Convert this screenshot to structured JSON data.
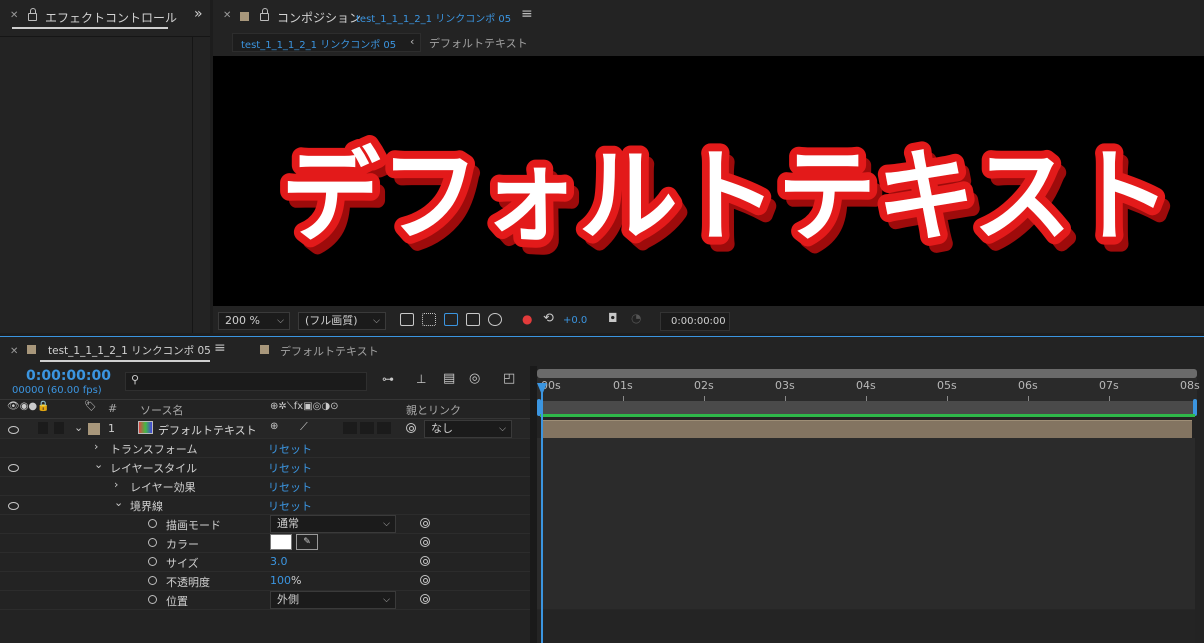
{
  "effects_panel": {
    "title": "エフェクトコントロール"
  },
  "comp_panel": {
    "title": "コンポジション",
    "comp_name": "test_1_1_1_2_1 リンクコンポ 05",
    "breadcrumb": [
      "test_1_1_1_2_1 リンクコンポ 05",
      "デフォルトテキスト"
    ],
    "preview_text": "デフォルトテキスト",
    "zoom": "200 %",
    "resolution": "(フル画質)",
    "exposure": "+0.0",
    "timecode": "0:00:00:00"
  },
  "timeline": {
    "tabs": [
      "test_1_1_1_2_1 リンクコンポ 05",
      "デフォルトテキスト"
    ],
    "current_time": "0:00:00:00",
    "frame_info": "00000 (60.00 fps)",
    "search_placeholder": "",
    "columns": {
      "num": "#",
      "source": "ソース名",
      "parent": "親とリンク"
    },
    "ruler": [
      "00s",
      "01s",
      "02s",
      "03s",
      "04s",
      "05s",
      "06s",
      "07s",
      "08s"
    ],
    "layer": {
      "num": "1",
      "name": "デフォルトテキスト",
      "parent": "なし"
    },
    "reset_label": "リセット",
    "props": {
      "transform": "トランスフォーム",
      "layer_style": "レイヤースタイル",
      "layer_effect": "レイヤー効果",
      "stroke": "境界線",
      "blend_mode": {
        "label": "描画モード",
        "value": "通常"
      },
      "color": {
        "label": "カラー",
        "value": "#ffffff"
      },
      "size": {
        "label": "サイズ",
        "value": "3.0"
      },
      "opacity": {
        "label": "不透明度",
        "value": "100",
        "unit": "%"
      },
      "position": {
        "label": "位置",
        "value": "外側"
      }
    }
  },
  "colors": {
    "accent": "#3b95e0",
    "label": "#a8977b",
    "work_bar": "#2fb84a",
    "text_fill": "#ffffff",
    "text_stroke": "#e31a1a"
  }
}
